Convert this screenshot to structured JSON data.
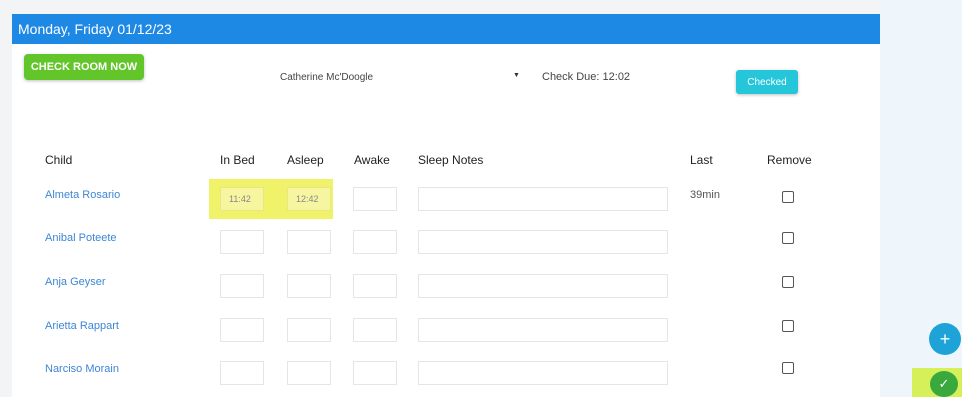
{
  "header": {
    "title": "Monday, Friday 01/12/23"
  },
  "toolbar": {
    "check_room_label": "CHECK ROOM NOW",
    "staff_selected": "Catherine Mc'Doogle",
    "check_due": "Check Due: 12:02",
    "checked_label": "Checked"
  },
  "table": {
    "columns": [
      "Child",
      "In Bed",
      "Asleep",
      "Awake",
      "Sleep Notes",
      "Last",
      "Remove"
    ],
    "rows": [
      {
        "child": "Almeta Rosario",
        "in_bed": "11:42",
        "asleep": "12:42",
        "awake": "",
        "notes": "",
        "last": "39min"
      },
      {
        "child": "Anibal Poteete",
        "in_bed": "",
        "asleep": "",
        "awake": "",
        "notes": "",
        "last": ""
      },
      {
        "child": "Anja Geyser",
        "in_bed": "",
        "asleep": "",
        "awake": "",
        "notes": "",
        "last": ""
      },
      {
        "child": "Arietta Rappart",
        "in_bed": "",
        "asleep": "",
        "awake": "",
        "notes": "",
        "last": ""
      },
      {
        "child": "Narciso Morain",
        "in_bed": "",
        "asleep": "",
        "awake": "",
        "notes": "",
        "last": ""
      }
    ]
  },
  "fab": {
    "add_glyph": "+",
    "confirm_glyph": "✓"
  },
  "colors": {
    "header": "#1e88e5",
    "check_room": "#62c52a",
    "checked": "#26c6da",
    "link": "#3d86d4",
    "highlight": "#f0f26a"
  },
  "icons": [
    "caret-down-icon",
    "plus-icon",
    "check-icon"
  ]
}
